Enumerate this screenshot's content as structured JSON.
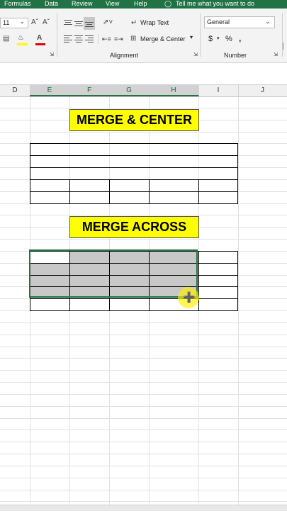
{
  "menu": {
    "tabs": [
      "Formulas",
      "Data",
      "Review",
      "View",
      "Help"
    ],
    "tell_me": "Tell me what you want to do"
  },
  "ribbon": {
    "font_size": "11",
    "wrap_text": "Wrap Text",
    "merge_center": "Merge & Center",
    "number_format": "General",
    "alignment_label": "Alignment",
    "number_label": "Number",
    "currency": "$",
    "percent": "%",
    "comma": ","
  },
  "columns": [
    "D",
    "E",
    "F",
    "G",
    "H",
    "I",
    "J"
  ],
  "sheet": {
    "banner1": "MERGE & CENTER",
    "banner2": "MERGE ACROSS"
  },
  "colors": {
    "excel_green": "#217346",
    "banner_yellow": "#ffff00",
    "selection_gray": "#c8c8c8"
  }
}
